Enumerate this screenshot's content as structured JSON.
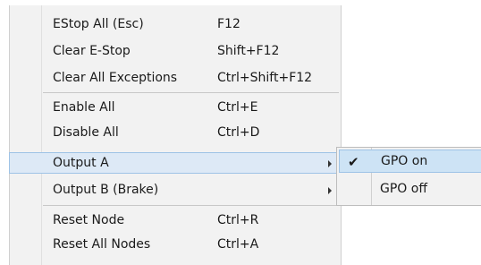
{
  "menu": {
    "items": [
      {
        "label": "EStop All (Esc)",
        "shortcut": "F12"
      },
      {
        "label": "Clear E-Stop",
        "shortcut": "Shift+F12"
      },
      {
        "label": "Clear All Exceptions",
        "shortcut": "Ctrl+Shift+F12"
      },
      {
        "label": "Enable All",
        "shortcut": "Ctrl+E"
      },
      {
        "label": "Disable All",
        "shortcut": "Ctrl+D"
      },
      {
        "label": "Output A",
        "shortcut": ""
      },
      {
        "label": "Output B (Brake)",
        "shortcut": ""
      },
      {
        "label": "Reset Node",
        "shortcut": "Ctrl+R"
      },
      {
        "label": "Reset All Nodes",
        "shortcut": "Ctrl+A"
      }
    ]
  },
  "submenu": {
    "items": [
      {
        "label": "GPO on",
        "checked": true,
        "check_glyph": "✔"
      },
      {
        "label": "GPO off",
        "checked": false
      }
    ]
  },
  "icons": {
    "submenu_arrow": "chevron-right-icon",
    "checkmark": "checkmark-icon"
  },
  "colors": {
    "menu_background": "#f2f2f2",
    "highlight_background": "#dde9f6",
    "highlight_border": "#9ec3e6",
    "selected_background": "#cde3f5"
  }
}
